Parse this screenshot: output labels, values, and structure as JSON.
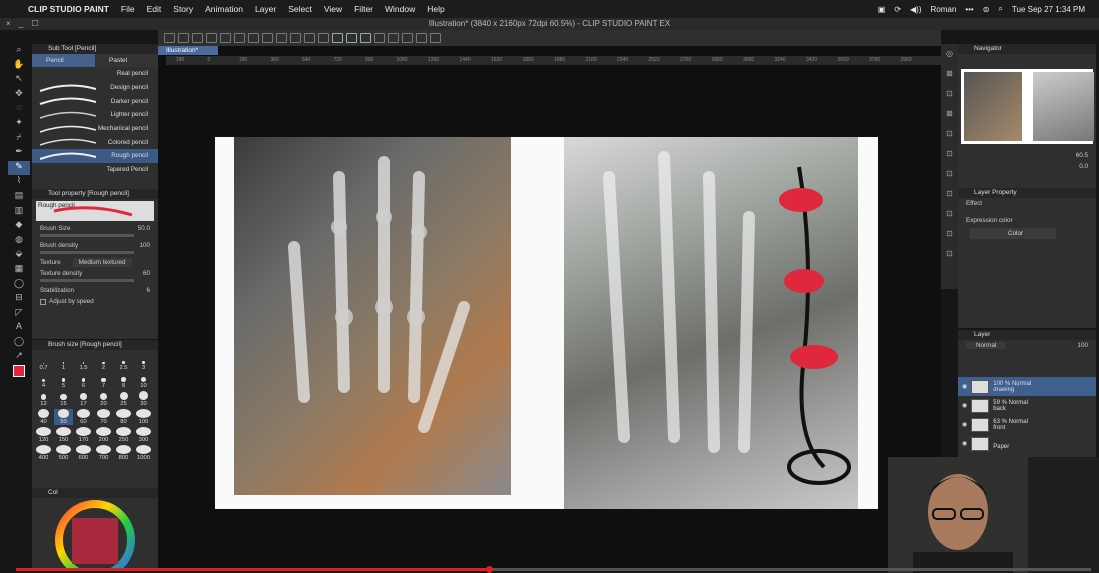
{
  "menubar": {
    "app": "CLIP STUDIO PAINT",
    "items": [
      "File",
      "Edit",
      "Story",
      "Animation",
      "Layer",
      "Select",
      "View",
      "Filter",
      "Window",
      "Help"
    ],
    "user": "Roman",
    "datetime": "Tue Sep 27  1:34 PM"
  },
  "window": {
    "title": "Illustration* (3840 x 2160px 72dpi 60.5%) - CLIP STUDIO PAINT EX",
    "controls": "× _ ☐"
  },
  "doc_tab": "Illustration*",
  "ruler": {
    "marks": [
      "180",
      "0",
      "180",
      "360",
      "540",
      "720",
      "900",
      "1080",
      "1260",
      "1440",
      "1620",
      "1800",
      "1980",
      "2160",
      "2340",
      "2520",
      "2700",
      "2880",
      "3060",
      "3240",
      "3420",
      "3600",
      "3780",
      "3960"
    ]
  },
  "subtool": {
    "title": "Sub Tool [Pencil]",
    "tabs": [
      "Pencil",
      "Pastel"
    ],
    "brushes": [
      "Real pencil",
      "Design pencil",
      "Darker pencil",
      "Lighter pencil",
      "Mechanical pencil",
      "Colored pencil",
      "Rough pencil",
      "Tapered Pencil"
    ],
    "selected": "Rough pencil"
  },
  "toolprop": {
    "title": "Tool property [Rough pencil]",
    "preview": "Rough pencil",
    "brush_size_label": "Brush Size",
    "brush_size": "50.0",
    "brush_density_label": "Brush density",
    "brush_density": "100",
    "texture_label": "Texture",
    "texture_value": "Medium textured",
    "texture_density_label": "Texture density",
    "texture_density": "60",
    "stabilization_label": "Stabilization",
    "stabilization": "6",
    "adjust_label": "Adjust by speed"
  },
  "brushsize": {
    "title": "Brush size [Rough pencil]",
    "sizes": [
      "0.7",
      "1",
      "1.5",
      "2",
      "2.5",
      "3",
      "4",
      "5",
      "6",
      "7",
      "8",
      "10",
      "12",
      "15",
      "17",
      "20",
      "25",
      "30",
      "40",
      "50",
      "60",
      "70",
      "80",
      "100",
      "120",
      "150",
      "170",
      "200",
      "250",
      "300",
      "400",
      "500",
      "600",
      "700",
      "800",
      "1000"
    ],
    "selected": "50"
  },
  "colorpanel": {
    "title": "Col"
  },
  "navigator": {
    "title": "Navigator",
    "zoom": "60.5",
    "rotate": "0.0"
  },
  "layerprop": {
    "title": "Layer Property",
    "effect": "Effect",
    "expression_label": "Expression color",
    "expression_value": "Color"
  },
  "layers": {
    "title": "Layer",
    "blend": "Normal",
    "opacity": "100",
    "rows": [
      {
        "pct": "100 %",
        "mode": "Normal",
        "name": "drawing",
        "sel": true
      },
      {
        "pct": "59 %",
        "mode": "Normal",
        "name": "back",
        "sel": false
      },
      {
        "pct": "63 %",
        "mode": "Normal",
        "name": "front",
        "sel": false
      },
      {
        "pct": "",
        "mode": "",
        "name": "Paper",
        "sel": false
      }
    ]
  },
  "video": {
    "progress": 0.44
  },
  "colors": {
    "accent": "#3c5a86",
    "progress": "#e51c23",
    "rough_stroke": "#e0283c"
  }
}
